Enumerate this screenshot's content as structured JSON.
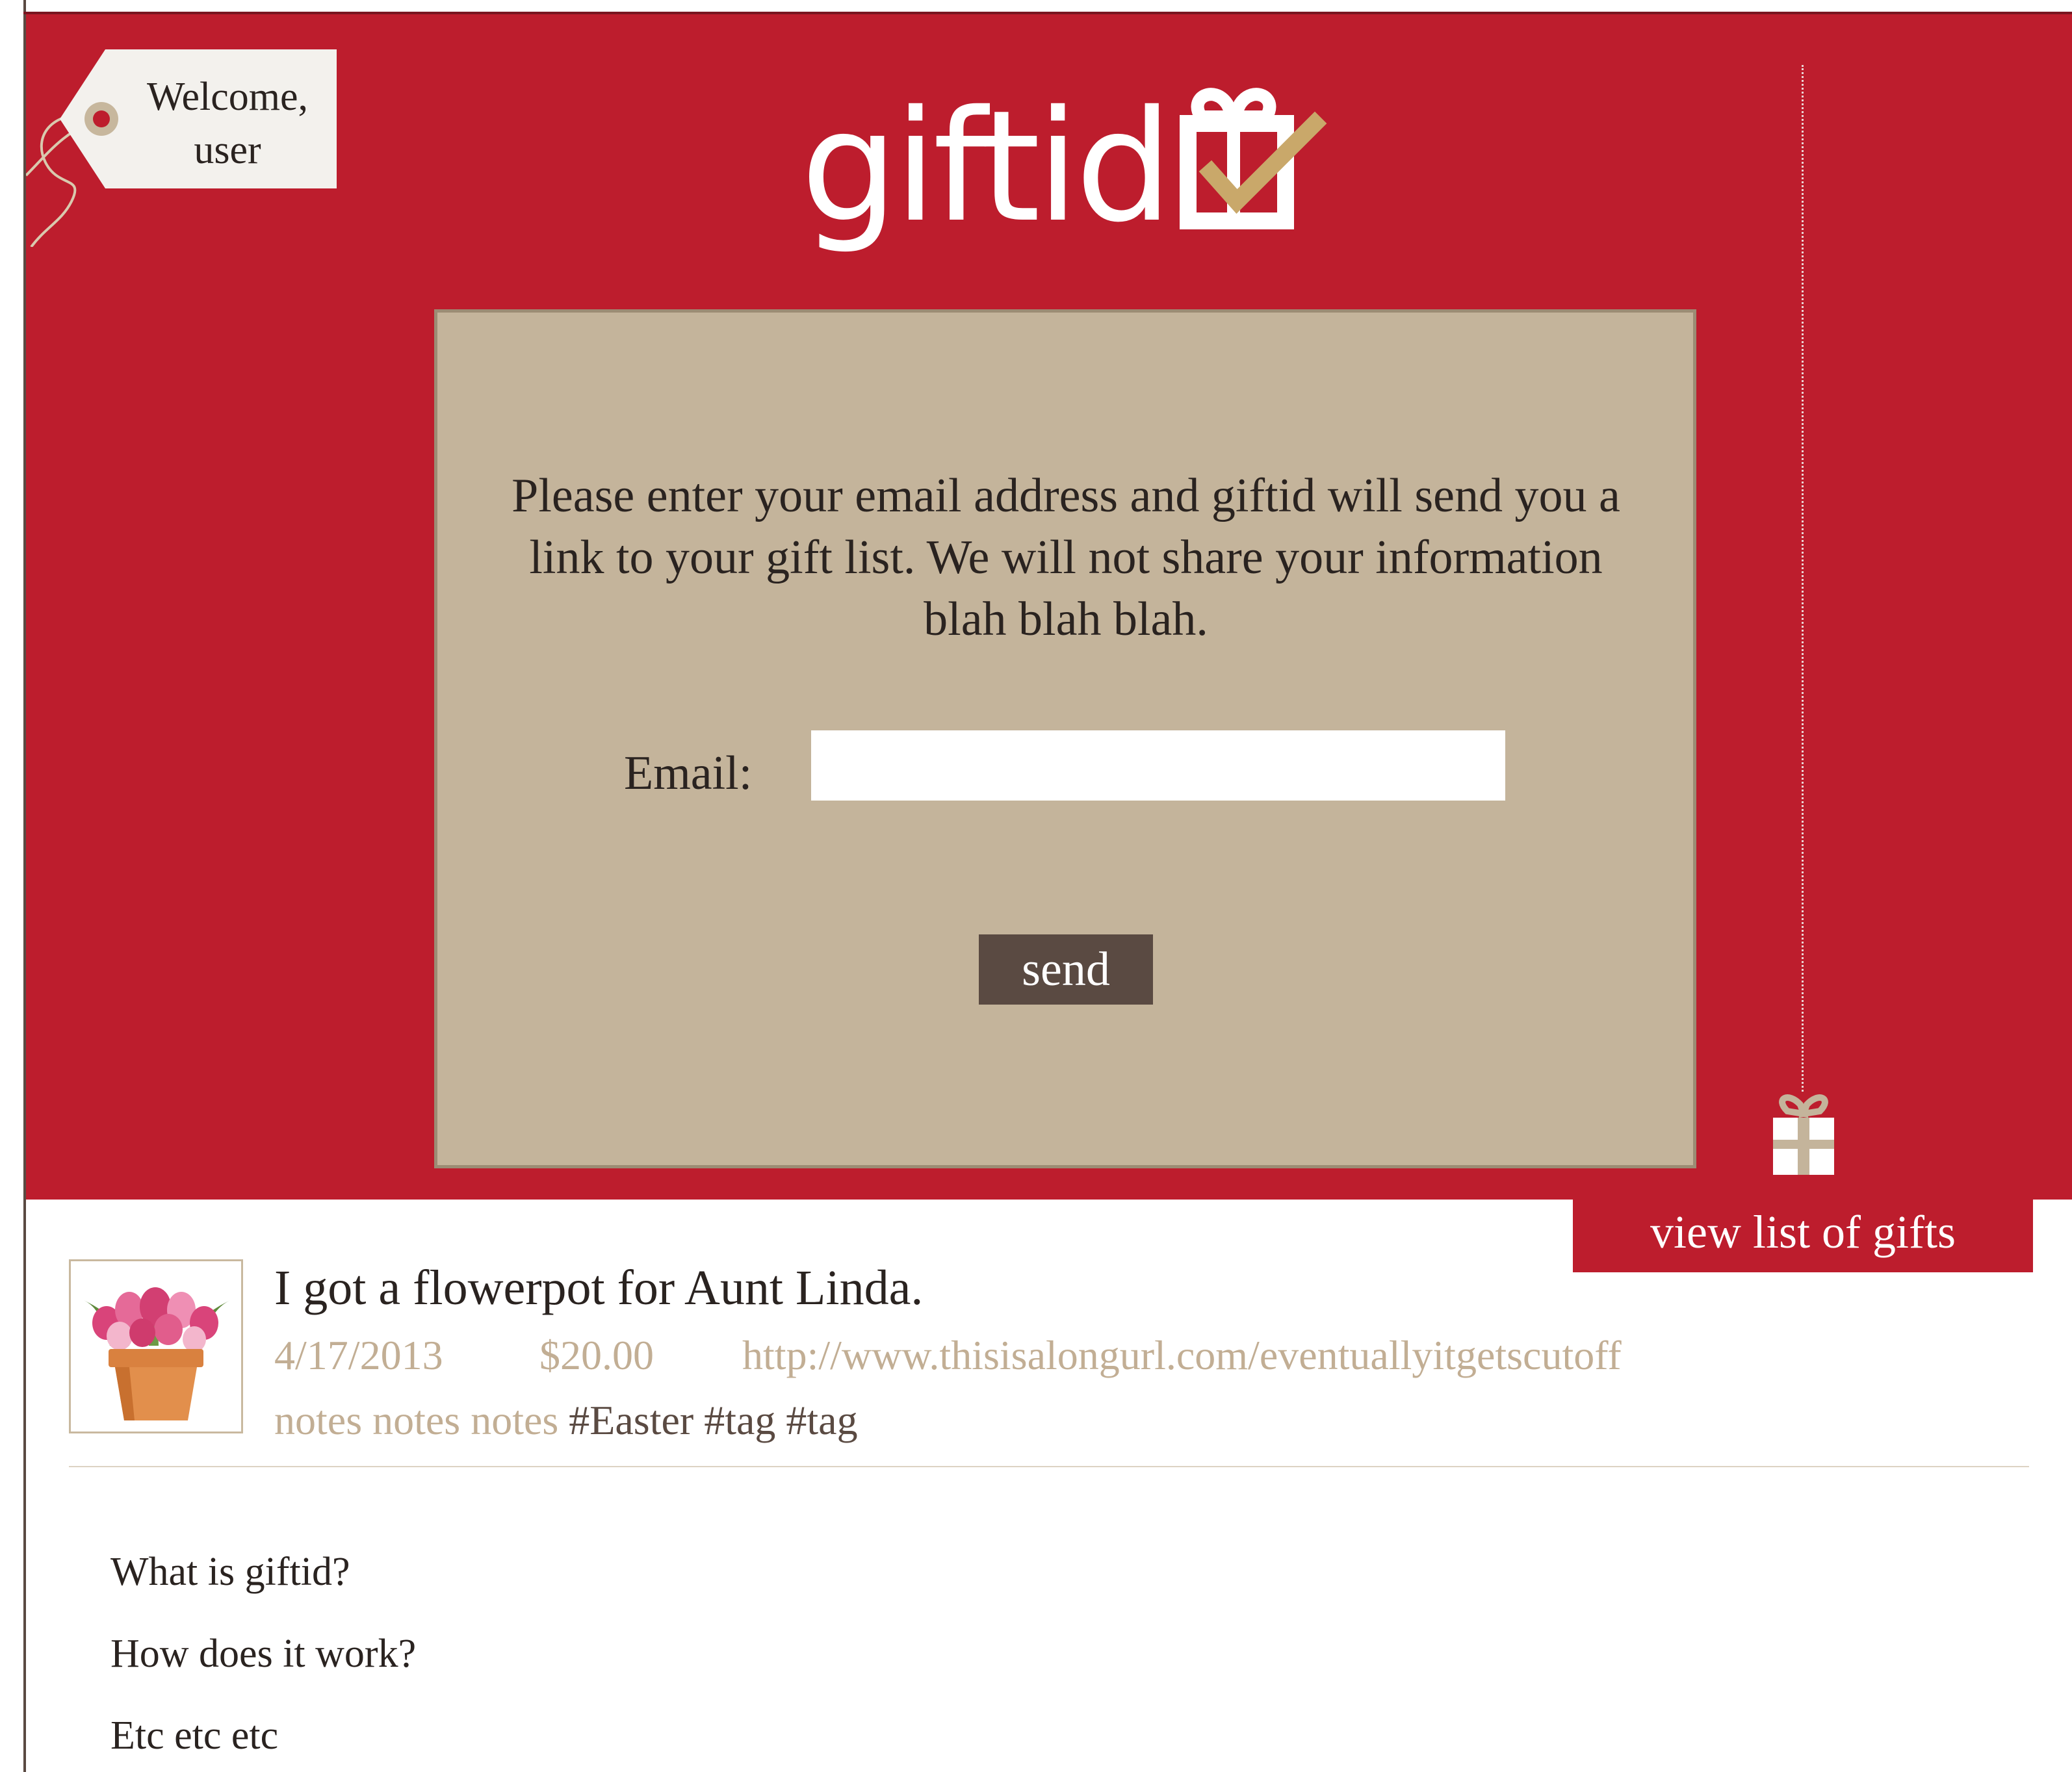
{
  "header": {
    "welcome_text": "Welcome, user",
    "logo_text": "giftid",
    "colors": {
      "brand_red": "#bd1d2d",
      "panel_tan": "#c4b49b",
      "dark_brown": "#5a4a42",
      "muted_tan_text": "#c2ae94",
      "gold_check": "#c9a86a"
    }
  },
  "form": {
    "message": "Please enter your email address and giftid will send you a link to your gift list. We will not share your information blah blah blah.",
    "email_label": "Email:",
    "email_value": "",
    "email_placeholder": "",
    "send_label": "send"
  },
  "gift_list_button": {
    "label": "view list of gifts",
    "icon": "gift-box-icon"
  },
  "gift_entry": {
    "title": "I got a flowerpot for Aunt Linda.",
    "date": "4/17/2013",
    "price": "$20.00",
    "url": "http://www.thisisalongurl.com/eventuallyitgetscutoff",
    "notes": "notes notes notes",
    "tags": [
      "#Easter",
      "#tag",
      "#tag"
    ],
    "image": "flowerpot-tulips-thumbnail"
  },
  "faq": [
    "What is giftid?",
    "How does it work?",
    "Etc etc etc"
  ]
}
